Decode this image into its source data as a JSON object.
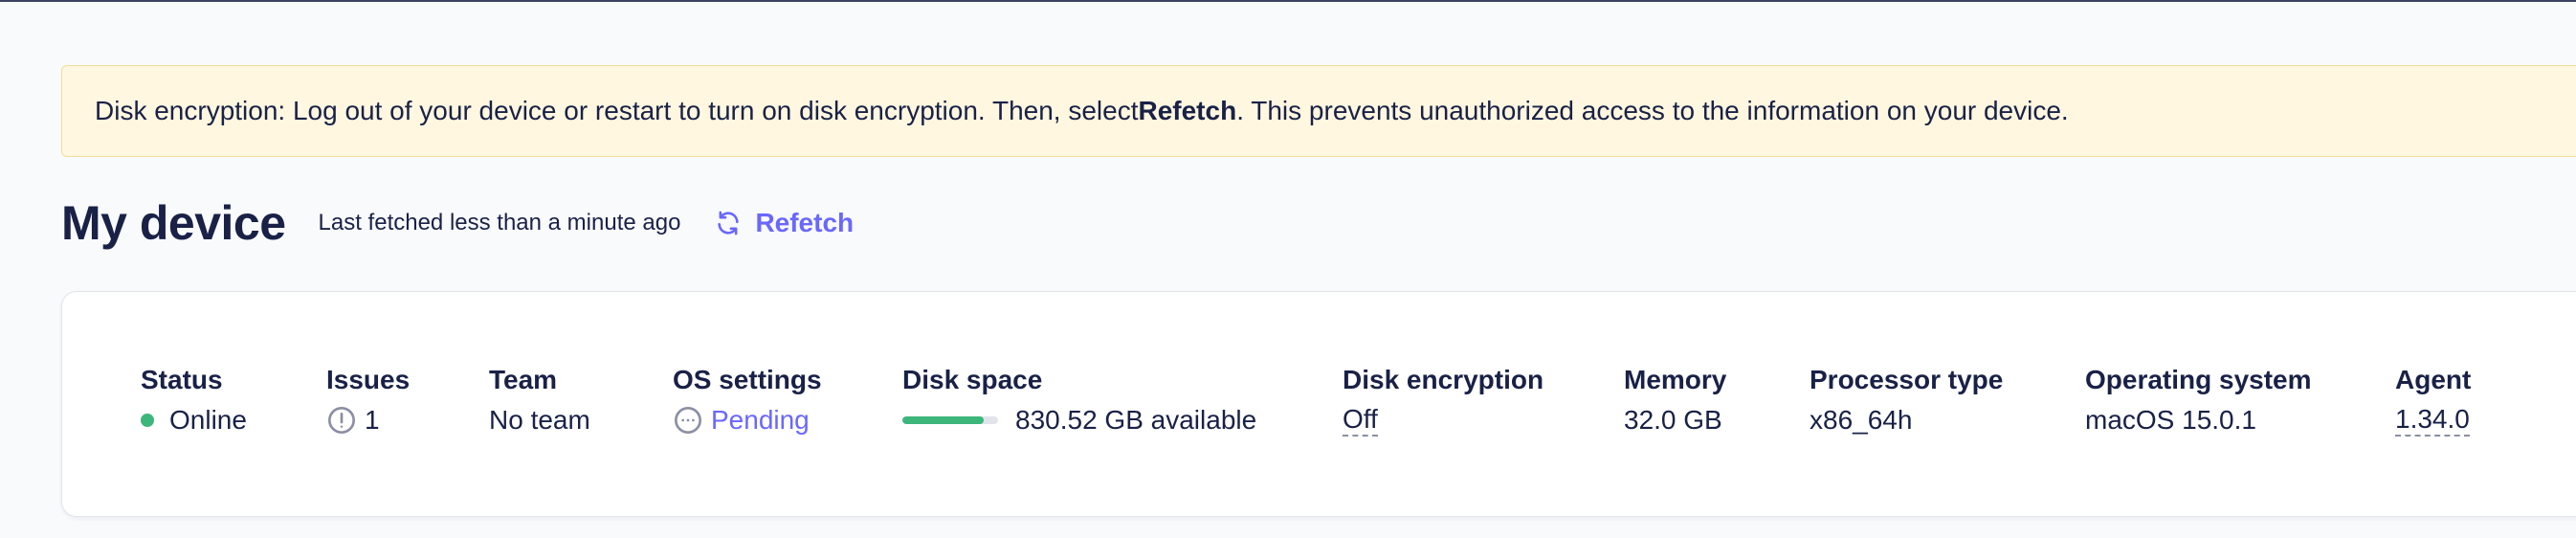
{
  "banner": {
    "prefix": "Disk encryption: Log out of your device or restart to turn on disk encryption. Then, select ",
    "bold": "Refetch",
    "suffix": ". This prevents unauthorized access to the information on your device."
  },
  "header": {
    "title": "My device",
    "last_fetched": "Last fetched less than a minute ago",
    "refetch_label": "Refetch"
  },
  "device": {
    "status": {
      "label": "Status",
      "value": "Online"
    },
    "issues": {
      "label": "Issues",
      "value": "1"
    },
    "team": {
      "label": "Team",
      "value": "No team"
    },
    "os_settings": {
      "label": "OS settings",
      "value": "Pending"
    },
    "disk_space": {
      "label": "Disk space",
      "value": "830.52 GB available",
      "used_fraction": 0.85
    },
    "disk_encryption": {
      "label": "Disk encryption",
      "value": "Off"
    },
    "memory": {
      "label": "Memory",
      "value": "32.0 GB"
    },
    "processor": {
      "label": "Processor type",
      "value": "x86_64h"
    },
    "os": {
      "label": "Operating system",
      "value": "macOS 15.0.1"
    },
    "agent": {
      "label": "Agent",
      "value": "1.34.0"
    }
  },
  "colors": {
    "accent": "#6a67fe",
    "online": "#3db67b",
    "banner_bg": "#fff7df",
    "text": "#192147"
  },
  "icons": {
    "refetch": "refresh-icon",
    "issues": "exclamation-circle-icon",
    "pending": "ellipsis-circle-icon"
  }
}
